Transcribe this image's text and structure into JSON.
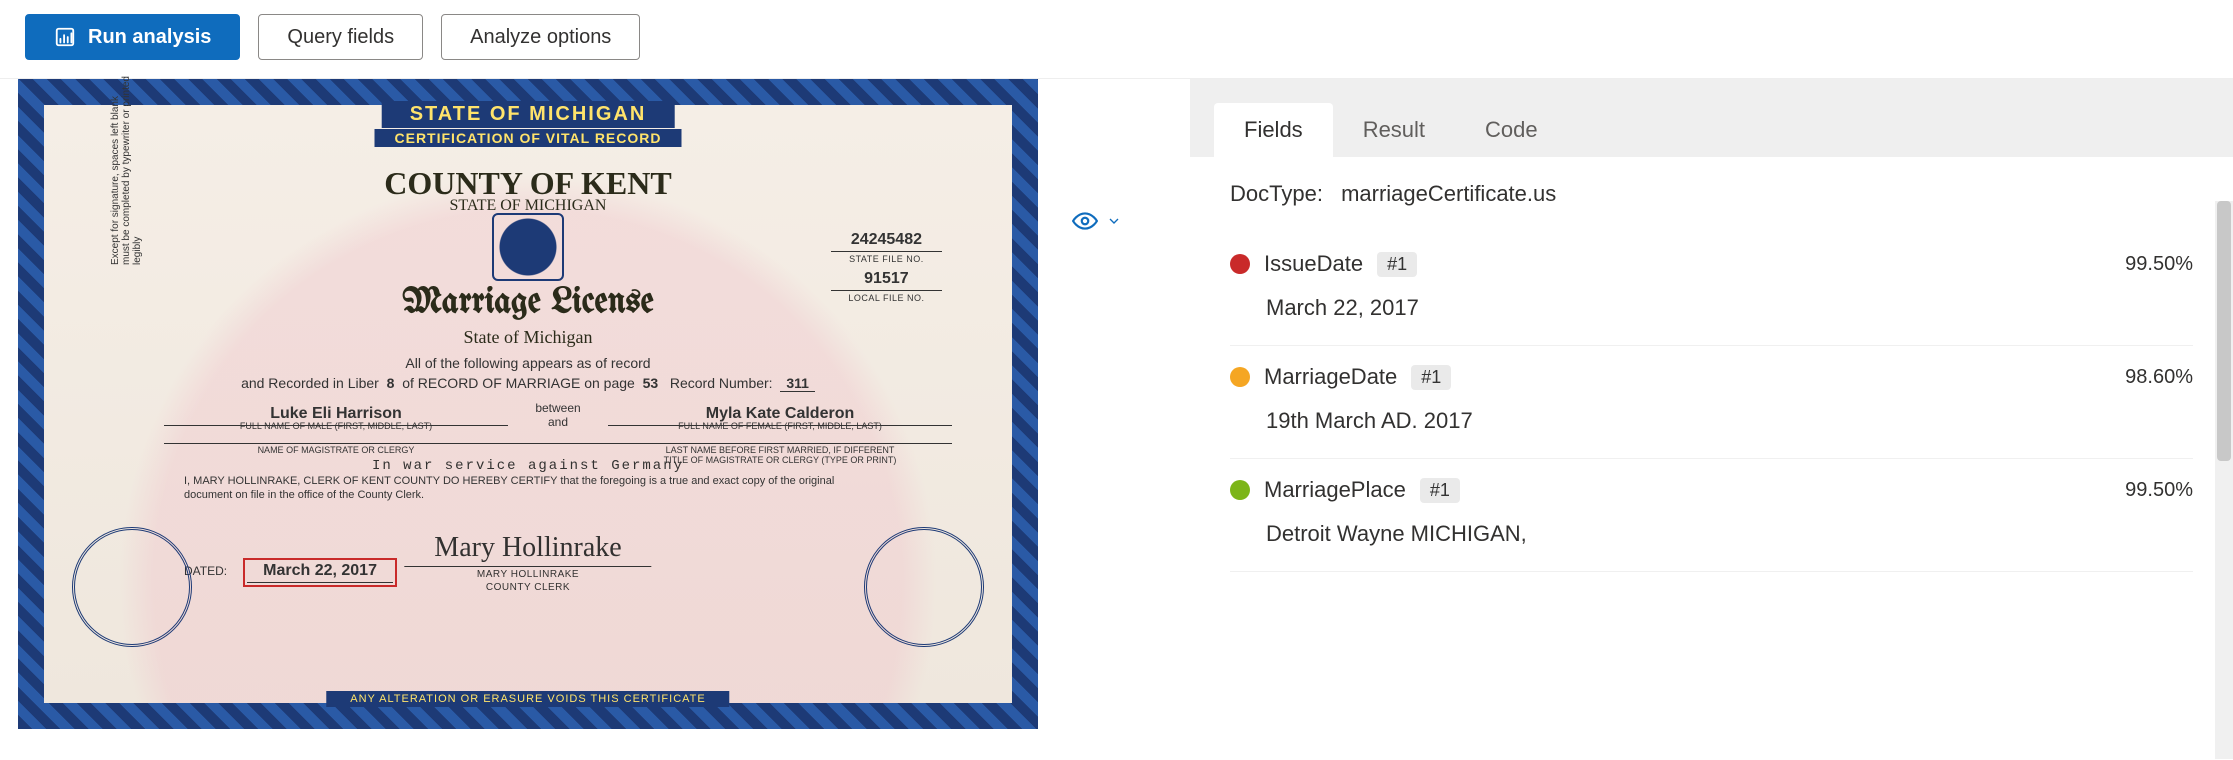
{
  "toolbar": {
    "run_analysis": "Run analysis",
    "query_fields": "Query fields",
    "analyze_options": "Analyze options"
  },
  "certificate": {
    "banner_top": "STATE OF MICHIGAN",
    "banner_sub": "CERTIFICATION OF VITAL RECORD",
    "county_line": "COUNTY OF KENT",
    "county_sub": "STATE OF MICHIGAN",
    "state_file_no": "24245482",
    "state_file_lbl": "STATE FILE NO.",
    "local_file_no": "91517",
    "local_file_lbl": "LOCAL FILE NO.",
    "title": "Marriage License",
    "state_line": "State of Michigan",
    "appears_line": "All of the following appears as of record",
    "liber_prefix": "and Recorded in Liber",
    "liber_no": "8",
    "liber_mid": "of RECORD OF MARRIAGE on page",
    "page_no": "53",
    "record_prefix": "Record Number:",
    "record_no": "311",
    "male_name": "Luke Eli Harrison",
    "female_name": "Myla Kate Calderon",
    "between_top": "between",
    "between_bottom": "and",
    "male_lbl": "FULL NAME OF MALE (FIRST, MIDDLE, LAST)",
    "female_lbl": "FULL NAME OF FEMALE (FIRST, MIDDLE, LAST)",
    "mag_lbl_left": "NAME OF MAGISTRATE OR CLERGY",
    "mag_lbl_right_top": "LAST NAME BEFORE FIRST MARRIED, IF DIFFERENT",
    "mag_lbl_right_bottom": "TITLE OF MAGISTRATE OR CLERGY (TYPE OR PRINT)",
    "war_line": "In war service against Germany",
    "certify_text": "I, MARY HOLLINRAKE, CLERK OF KENT COUNTY DO HEREBY CERTIFY that the foregoing is a true and exact copy of the original document on file in the office of the County Clerk.",
    "signature": "Mary Hollinrake",
    "sig_name": "MARY HOLLINRAKE",
    "sig_title": "COUNTY CLERK",
    "dated_lbl": "DATED:",
    "dated_val": "March 22, 2017",
    "bottom_ribbon": "ANY ALTERATION OR ERASURE VOIDS THIS CERTIFICATE",
    "rot_note": "Except for signature, spaces left blank must be completed by typewriter or printed legibly"
  },
  "tabs": {
    "fields": "Fields",
    "result": "Result",
    "code": "Code",
    "active": "fields"
  },
  "doctype": {
    "label": "DocType:",
    "value": "marriageCertificate.us"
  },
  "fields": [
    {
      "color": "#c92a2a",
      "name": "IssueDate",
      "badge": "#1",
      "confidence": "99.50%",
      "value": "March 22, 2017"
    },
    {
      "color": "#f5a623",
      "name": "MarriageDate",
      "badge": "#1",
      "confidence": "98.60%",
      "value": "19th March AD. 2017"
    },
    {
      "color": "#7cb518",
      "name": "MarriagePlace",
      "badge": "#1",
      "confidence": "99.50%",
      "value": "Detroit Wayne MICHIGAN,"
    }
  ]
}
